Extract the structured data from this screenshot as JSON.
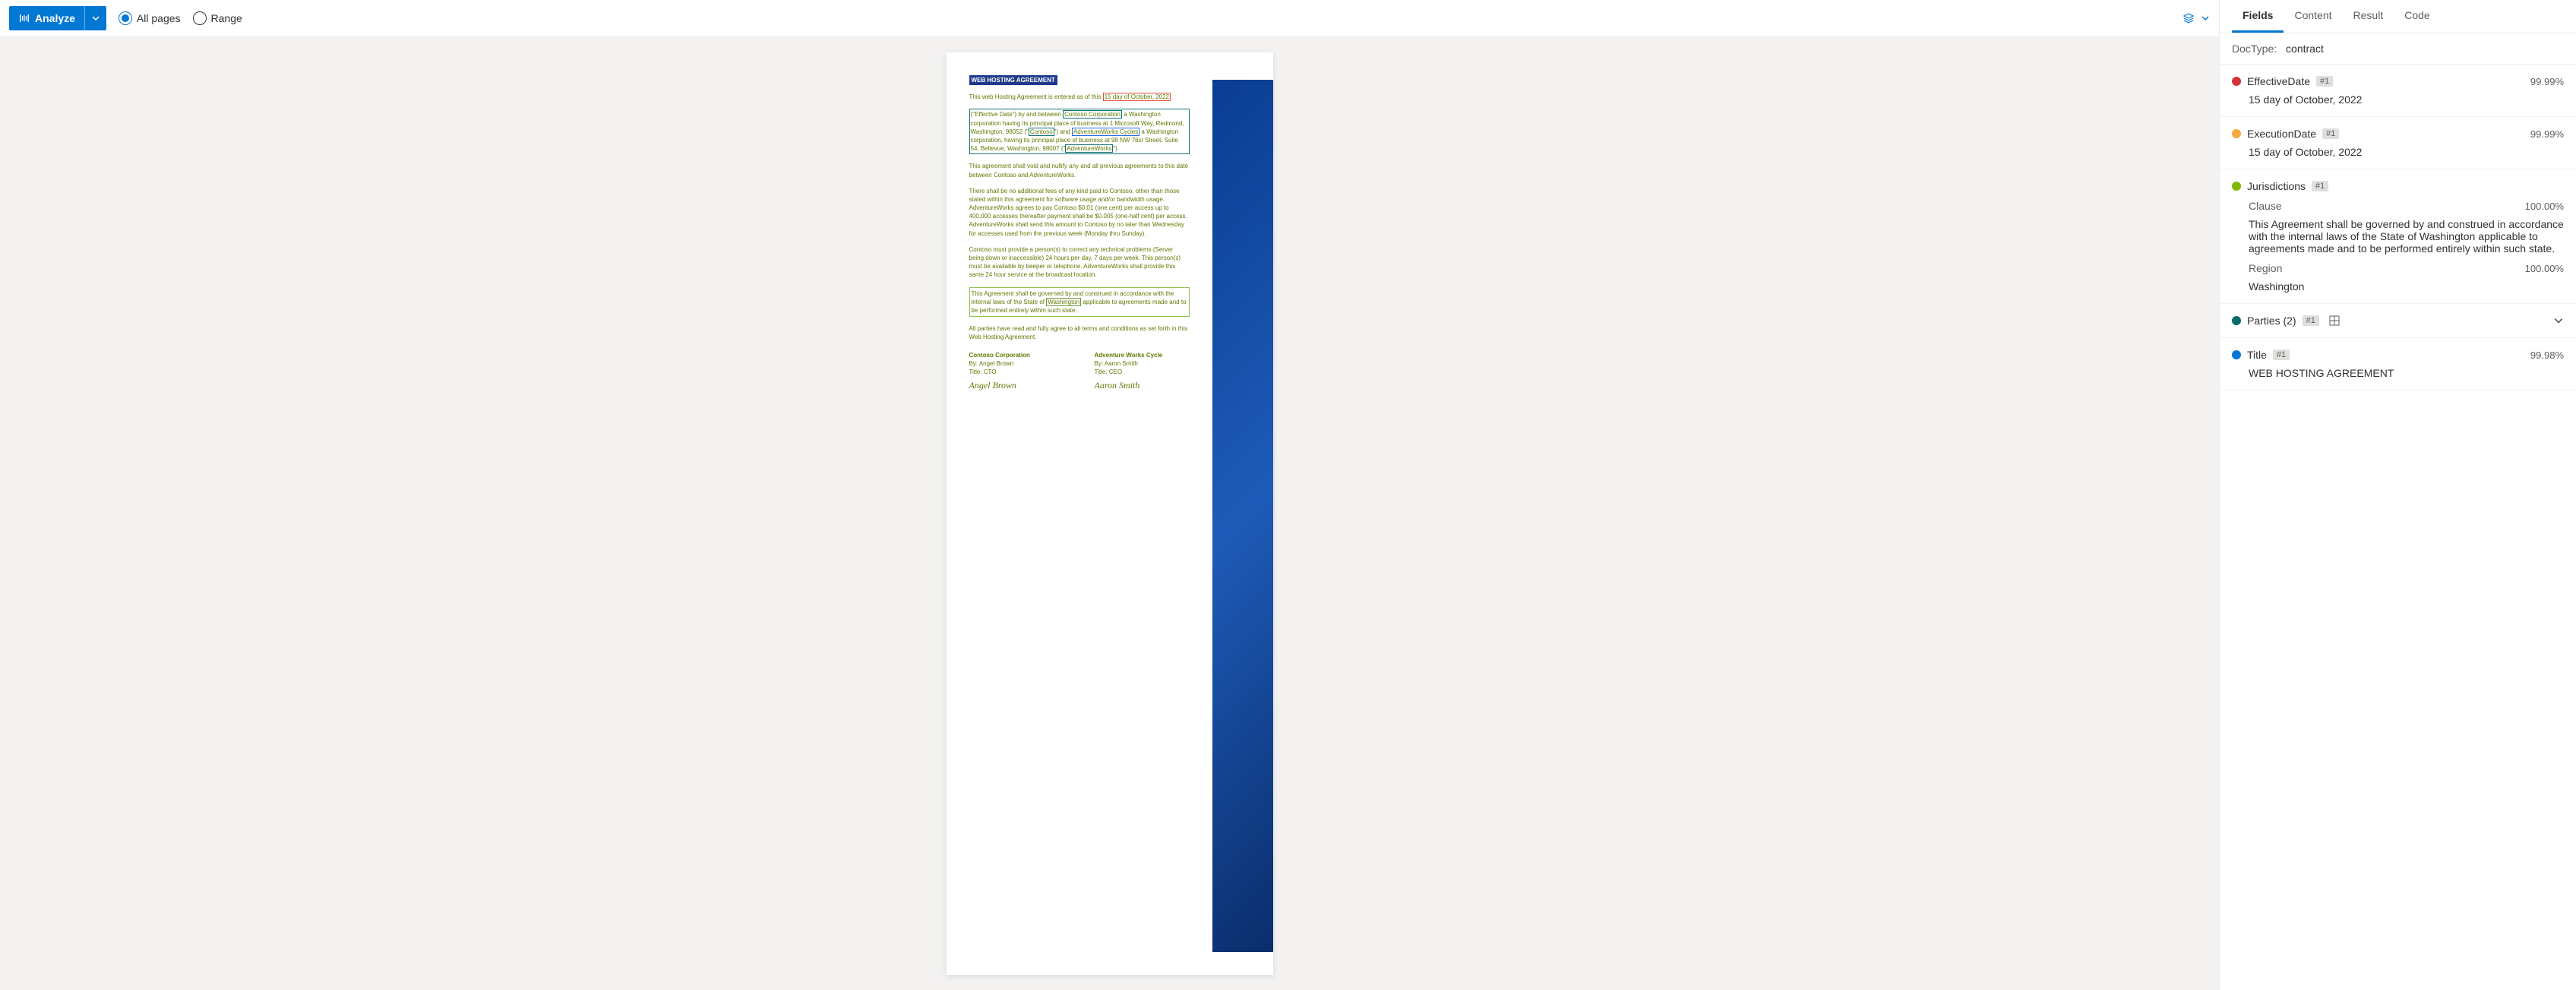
{
  "toolbar": {
    "analyze_label": "Analyze",
    "all_pages_label": "All pages",
    "range_label": "Range"
  },
  "tabs": [
    "Fields",
    "Content",
    "Result",
    "Code"
  ],
  "doctype": {
    "label": "DocType:",
    "value": "contract"
  },
  "fields": {
    "effective_date": {
      "name": "EffectiveDate",
      "badge": "#1",
      "conf": "99.99%",
      "value": "15 day of October, 2022",
      "color": "#d13438"
    },
    "execution_date": {
      "name": "ExecutionDate",
      "badge": "#1",
      "conf": "99.99%",
      "value": "15 day of October, 2022",
      "color": "#f7a93b"
    },
    "jurisdictions": {
      "name": "Jurisdictions",
      "badge": "#1",
      "color": "#7fba00",
      "clause": {
        "label": "Clause",
        "conf": "100.00%",
        "value": "This Agreement shall be governed by and construed in accordance with the internal laws of the State of Washington applicable to agreements made and to be performed entirely within such state."
      },
      "region": {
        "label": "Region",
        "conf": "100.00%",
        "value": "Washington"
      }
    },
    "parties": {
      "name": "Parties (2)",
      "badge": "#1",
      "color": "#0b6a6a"
    },
    "title": {
      "name": "Title",
      "badge": "#1",
      "conf": "99.98%",
      "value": "WEB HOSTING AGREEMENT",
      "color": "#0078d4"
    }
  },
  "doc": {
    "title": "WEB HOSTING AGREEMENT",
    "p1_pre": "This web Hosting Agreement is entered as of this ",
    "p1_date": "15 day of October, 2022",
    "p2a": "(\"Effective Date\") by and between ",
    "p2_corp": "Contoso Corporation",
    "p2b": " a Washington corporation having its principal place of business at 1 Microsoft Way, Redmond, Washington, 98052 (\"",
    "p2_contoso": "Contoso",
    "p2c": "\") and ",
    "p2_adv": "AdventureWorks Cycles",
    "p2d": " a Washington corporation, having its principal place of business at 98 NW 76st Street, Suite 54, Bellevue, Washington, 98007 (\"",
    "p2_adv2": "AdventureWorks",
    "p2e": "\").",
    "p3": "This agreement shall void and nullify any and all previous agreements to this date between Contoso and AdventureWorks.",
    "p4": "There shall be no additional fees of any kind paid to Contoso, other than those stated within this agreement for software usage and/or bandwidth usage. AdventureWorks agrees to pay Contoso $0.01 (one cent) per access up to 400,000 accesses thereafter payment shall be $0.005 (one-half cent) per access. AdventureWorks shall send this amount to Contoso by no later than Wednesday for accesses used from the previous week (Monday thru Sunday).",
    "p5": "Contoso must provide a person(s) to correct any technical problems (Server being down or inaccessible) 24 hours per day, 7 days per week. This person(s) must be available by beeper or telephone. AdventureWorks shall provide this same 24 hour service at the broadcast location.",
    "p6a": "This Agreement shall be governed by and construed in accordance with the internal laws of the State of ",
    "p6_region": "Washington",
    "p6b": " applicable to agreements made and to be performed entirely within such state.",
    "p7": "All parties have read and fully agree to all terms and conditions as set forth in this Web Hosting Agreement.",
    "sig1": {
      "company": "Contoso Corporation",
      "by": "By: Angel Brown",
      "title": "Title: CTO",
      "sig": "Angel Brown"
    },
    "sig2": {
      "company": "Adventure Works Cycle",
      "by": "By: Aaron Smith",
      "title": "Title: CEO",
      "sig": "Aaron Smith"
    }
  }
}
